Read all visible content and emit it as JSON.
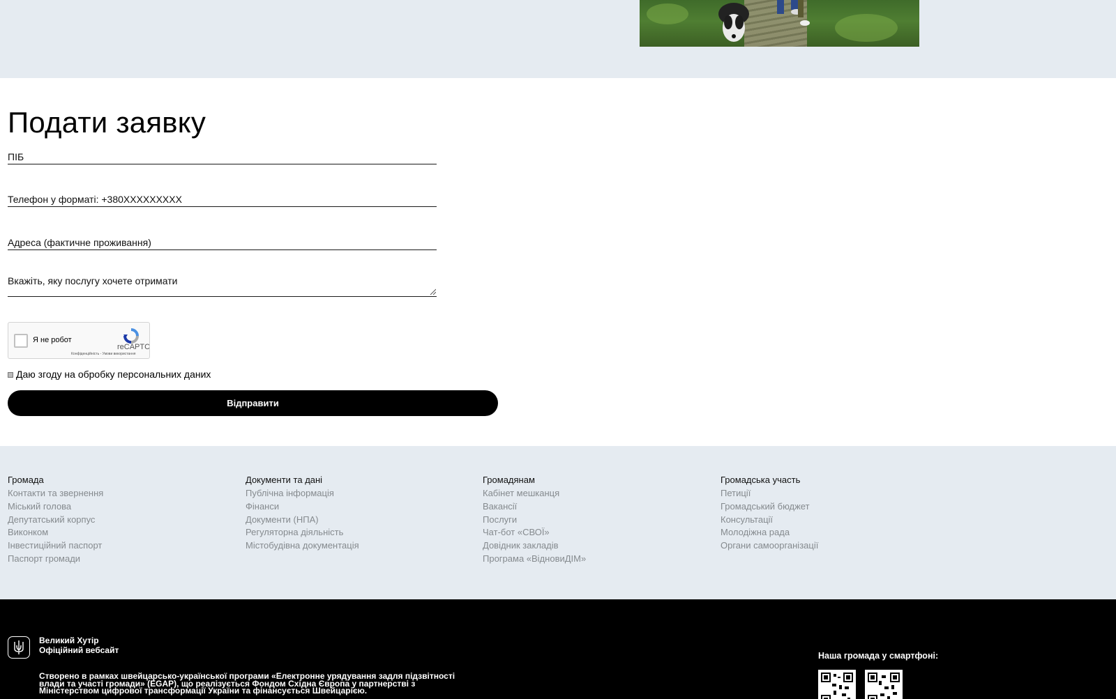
{
  "form": {
    "title": "Подати заявку",
    "name_field": "ПІБ",
    "phone_field": "Телефон у форматі: +380XXXXXXXXX",
    "address_field": "Адреса (фактичне проживання)",
    "service_field": "Вкажіть, яку послугу хочете отримати",
    "recaptcha_label": "Я не робот",
    "recaptcha_brand": "reCAPTC",
    "recaptcha_privacy": "Конфіденційність - Умови використання",
    "consent_label": "Даю згоду на обробку персональних даних",
    "submit_label": "Відправити"
  },
  "footer_links": {
    "columns": [
      {
        "heading": "Громада",
        "links": [
          "Контакти та звернення",
          "Міський голова",
          "Депутатський корпус",
          "Виконком",
          "Інвестиційний паспорт",
          "Паспорт громади"
        ]
      },
      {
        "heading": "Документи та дані",
        "links": [
          "Публічна інформація",
          "Фінанси",
          "Документи (НПА)",
          "Регуляторна діяльність",
          "Містобудівна документація"
        ]
      },
      {
        "heading": "Громадянам",
        "links": [
          "Кабінет мешканця",
          "Вакансії",
          "Послуги",
          "Чат-бот «СВОЇ»",
          "Довідник закладів",
          "Програма «ВідновиДІМ»"
        ]
      },
      {
        "heading": "Громадська участь",
        "links": [
          "Петиції",
          "Громадський бюджет",
          "Консультації",
          "Молодіжна рада",
          "Органи самоорганізації"
        ]
      }
    ]
  },
  "footer_bottom": {
    "site_name_line1": "Великий Хутір",
    "site_name_line2": "Офіційний вебсайт",
    "about": "Створено в рамках швейцарсько-української програми «Електронне урядування задля підзвітності влади та участі громади» (EGAP), що реалізується Фондом Східна Європа у партнерстві з Міністерством цифрової трансформації України та фінансується Швейцарією.",
    "mobile_label": "Наша громада у смартфоні:"
  },
  "icons": {
    "emblem": "trident-icon",
    "recaptcha": "recaptcha-logo-icon",
    "resize": "resize-handle-icon",
    "qr": "qr-code-icon"
  },
  "colors": {
    "band_background": "#e5ebf1",
    "footer_link": "#858a8e",
    "button_background": "#000000",
    "footer_background": "#000000"
  }
}
